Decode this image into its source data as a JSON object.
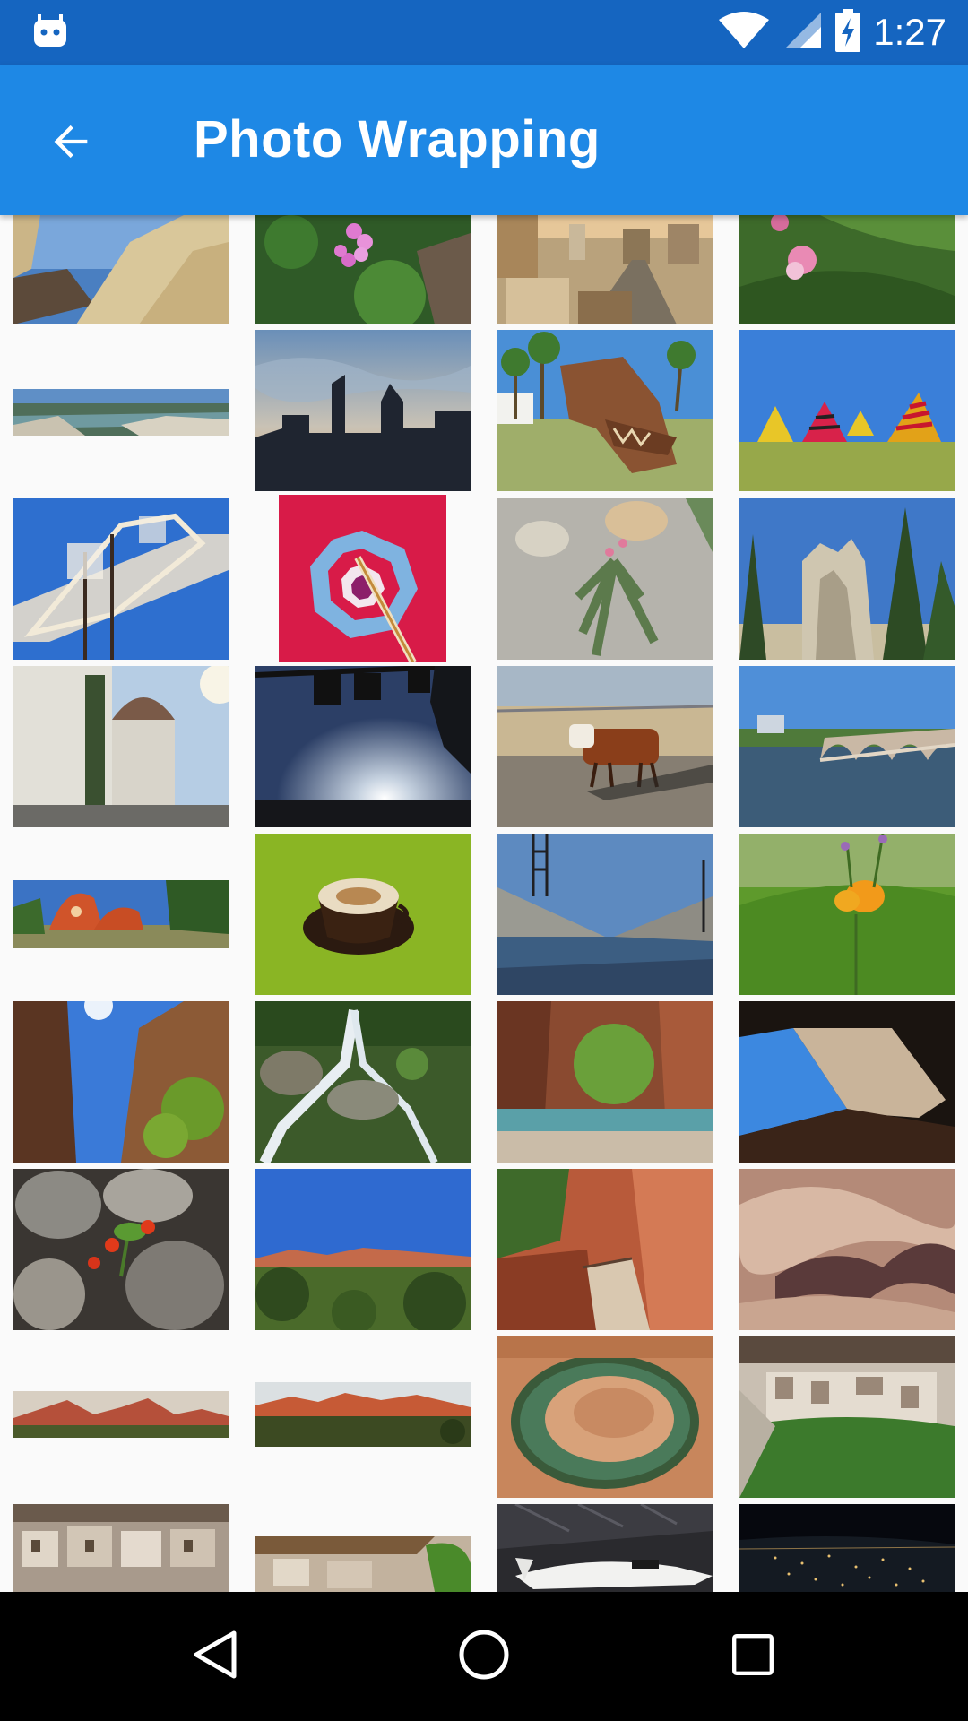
{
  "status_bar": {
    "time": "1:27",
    "left_icon": "android-notification-icon",
    "icons": [
      "wifi-icon",
      "signal-icon",
      "battery-charging-icon"
    ]
  },
  "app_bar": {
    "title": "Photo Wrapping",
    "back_icon": "arrow-back-icon"
  },
  "photos": [
    {
      "id": "cliff-rock"
    },
    {
      "id": "pink-flowers"
    },
    {
      "id": "city-street-aerial"
    },
    {
      "id": "columbine-flower"
    },
    {
      "id": "river-rocks-panorama"
    },
    {
      "id": "city-skyline-sunset"
    },
    {
      "id": "metal-dinosaur-sculpture"
    },
    {
      "id": "festival-tents"
    },
    {
      "id": "mirror-sculpture"
    },
    {
      "id": "umbrella-closeup"
    },
    {
      "id": "aloe-plant-gravel"
    },
    {
      "id": "rock-formation-pines"
    },
    {
      "id": "observatory-building"
    },
    {
      "id": "sun-traffic-lights"
    },
    {
      "id": "cow-road"
    },
    {
      "id": "bridge-river"
    },
    {
      "id": "dome-house"
    },
    {
      "id": "latte-cup"
    },
    {
      "id": "concrete-channel"
    },
    {
      "id": "lily-meadow"
    },
    {
      "id": "canyon-looking-up"
    },
    {
      "id": "waterfall"
    },
    {
      "id": "canyon-creek"
    },
    {
      "id": "cave-arch"
    },
    {
      "id": "red-flowers-rocks"
    },
    {
      "id": "mesa-landscape"
    },
    {
      "id": "canyon-trail"
    },
    {
      "id": "sandstone-waves"
    },
    {
      "id": "red-cliffs-panorama"
    },
    {
      "id": "sunset-ridge-panorama"
    },
    {
      "id": "horseshoe-bend"
    },
    {
      "id": "cliff-dwellings"
    },
    {
      "id": "cliff-palace-ruins"
    },
    {
      "id": "ruins-panorama"
    },
    {
      "id": "space-shuttle"
    },
    {
      "id": "city-lights-night"
    }
  ],
  "nav_bar": {
    "buttons": [
      "back-triangle-icon",
      "home-circle-icon",
      "recents-square-icon"
    ]
  }
}
